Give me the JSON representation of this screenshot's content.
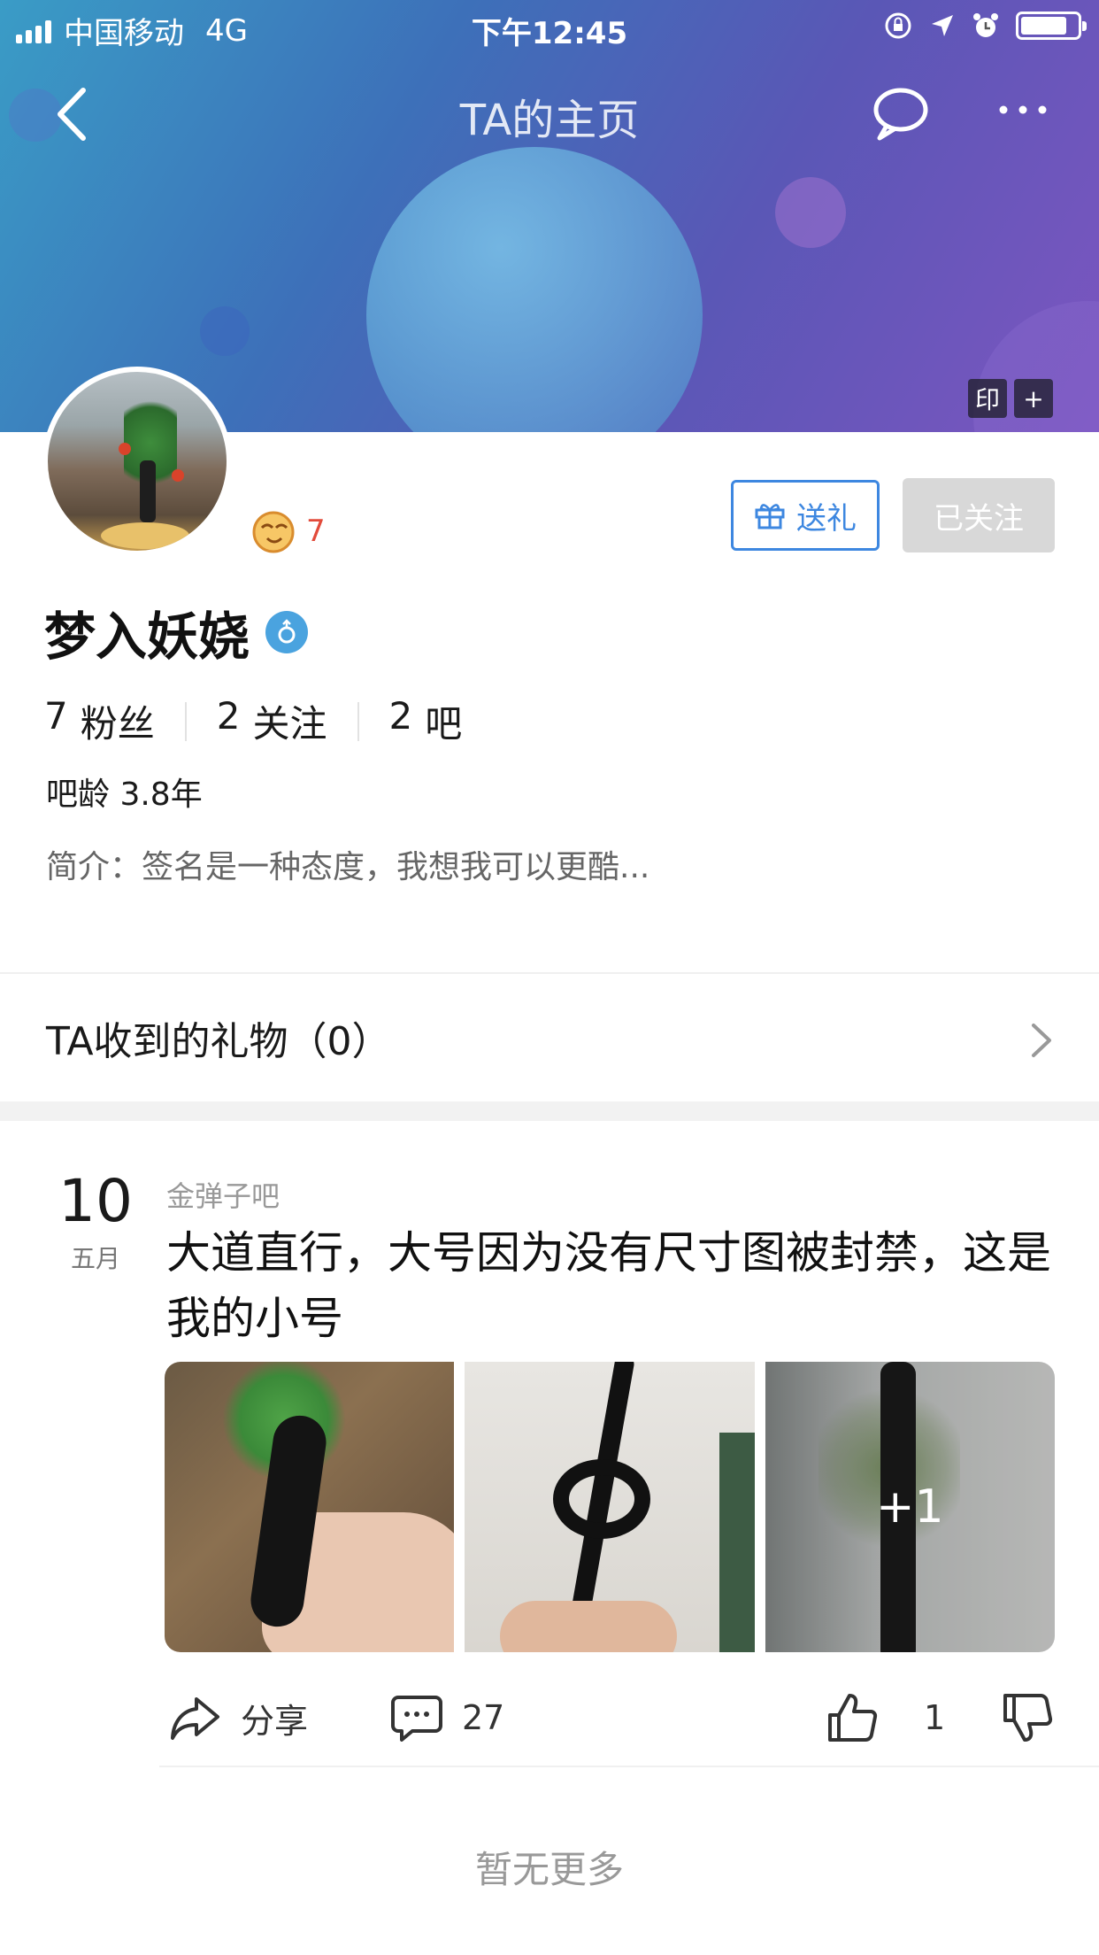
{
  "status_bar": {
    "carrier": "中国移动",
    "network": "4G",
    "time": "下午12:45"
  },
  "nav": {
    "title": "TA的主页"
  },
  "banner_tags": [
    "印",
    "+"
  ],
  "profile": {
    "level": "7",
    "gift_button": "送礼",
    "follow_button": "已关注",
    "username": "梦入妖娆",
    "stats": [
      {
        "value": "7",
        "label": "粉丝"
      },
      {
        "value": "2",
        "label": "关注"
      },
      {
        "value": "2",
        "label": "吧"
      }
    ],
    "age": "吧龄 3.8年",
    "intro": "简介：签名是一种态度，我想我可以更酷..."
  },
  "gifts": {
    "label": "TA收到的礼物（0）"
  },
  "post": {
    "day": "10",
    "month": "五月",
    "forum": "金弹子吧",
    "title": "大道直行，大号因为没有尺寸图被封禁，这是我的小号",
    "extra_images": "+1",
    "share_label": "分享",
    "comment_count": "27",
    "like_count": "1"
  },
  "footer": {
    "no_more": "暂无更多"
  },
  "colors": {
    "accent_blue": "#3d87e0",
    "level_red": "#e24b3b",
    "followed_grey": "#d8d8d8"
  }
}
